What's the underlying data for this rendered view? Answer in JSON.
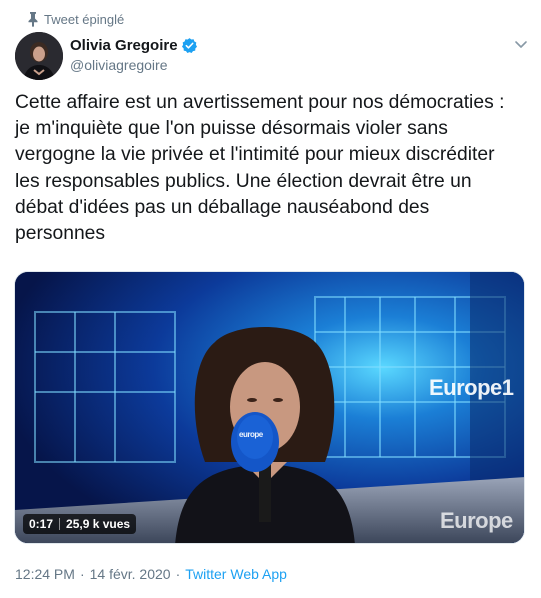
{
  "pinned": {
    "label": "Tweet épinglé",
    "icon": "pin-icon"
  },
  "author": {
    "display_name": "Olivia Gregoire",
    "handle": "@oliviagregoire",
    "verified": true,
    "verified_color": "#1da1f2"
  },
  "tweet": {
    "text": "Cette affaire est un avertissement pour nos démocraties :\nje m'inquiète que l'on puisse désormais violer sans\nvergogne la vie privée et l'intimité pour mieux discréditer\nles responsables publics. Une élection devrait être un\ndébat d'idées pas un déballage nauséabond des\npersonnes"
  },
  "media": {
    "duration": "0:17",
    "views": "25,9 k vues",
    "brand_main": "Europe",
    "brand_num": "1",
    "brand_bottom": "Europe",
    "mic_label": "europe"
  },
  "meta": {
    "time": "12:24 PM",
    "separator": "·",
    "date": "14 févr. 2020",
    "source": "Twitter Web App"
  },
  "colors": {
    "text": "#14171a",
    "secondary": "#657786",
    "accent": "#1da1f2"
  }
}
